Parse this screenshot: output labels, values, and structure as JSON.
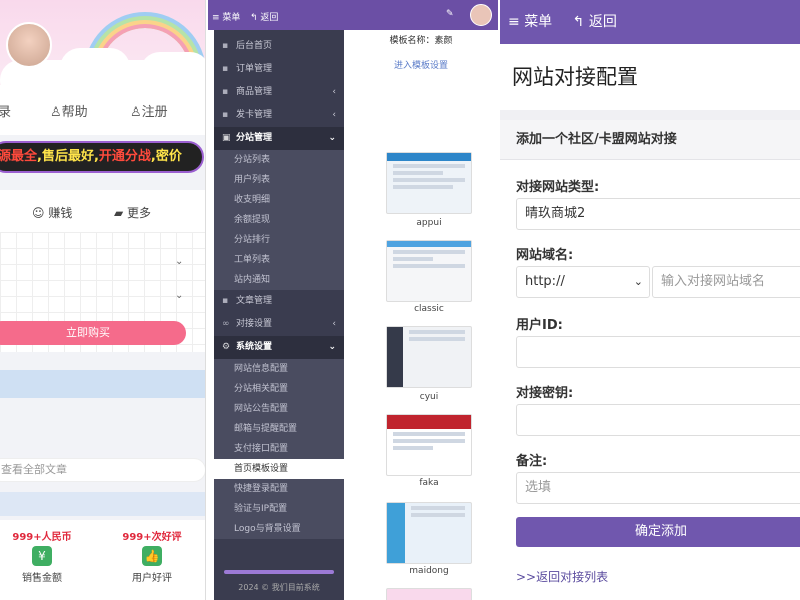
{
  "panel1": {
    "tabs": [
      "录",
      "帮助",
      "注册"
    ],
    "banner": {
      "red1": "源最全",
      "yellow": ",售后最好,",
      "red2": "开通分战",
      "yellow2": ",密价"
    },
    "menu2": [
      "赚钱",
      "更多"
    ],
    "buy": "立即购买",
    "search": "查看全部文章",
    "stats": [
      {
        "n": "999+人民币",
        "l": "销售金额"
      },
      {
        "n": "999+次好评",
        "l": "用户好评"
      }
    ]
  },
  "panel2": {
    "top": {
      "menu": "菜单",
      "back": "返回"
    },
    "sidebar": [
      {
        "t": "后台首页"
      },
      {
        "t": "订单管理"
      },
      {
        "t": "商品管理",
        "arrow": true
      },
      {
        "t": "发卡管理",
        "arrow": true
      },
      {
        "t": "分站管理",
        "arrow": true,
        "active": true
      }
    ],
    "sub1": [
      "分站列表",
      "用户列表",
      "收支明细",
      "余额提现",
      "分站排行",
      "工单列表",
      "站内通知"
    ],
    "sidebar2": [
      {
        "t": "文章管理"
      },
      {
        "t": "对接设置",
        "arrow": true
      },
      {
        "t": "系统设置",
        "arrow": true,
        "active": true
      }
    ],
    "sub2": [
      "网站信息配置",
      "分站相关配置",
      "网站公告配置",
      "邮箱与提醒配置",
      "支付接口配置",
      "首页模板设置",
      "快捷登录配置",
      "验证与IP配置",
      "Logo与背景设置"
    ],
    "current_sub": "首页模板设置",
    "footer": "2024 © 我们目前系统",
    "template_label": "模板名称：素颜",
    "enter_template": "进入模板设置",
    "templates": [
      "appui",
      "classic",
      "cyui",
      "faka",
      "maidong"
    ]
  },
  "panel3": {
    "top": {
      "menu": "菜单",
      "back": "返回"
    },
    "title": "网站对接配置",
    "section": "添加一个社区/卡盟网站对接",
    "type_label": "对接网站类型:",
    "type_value": "晴玖商城2",
    "domain_label": "网站域名:",
    "protocol": "http://",
    "domain_placeholder": "输入对接网站域名",
    "userid_label": "用户ID:",
    "key_label": "对接密钥:",
    "remark_label": "备注:",
    "remark_placeholder": "选填",
    "submit": "确定添加",
    "back_link": ">>返回对接列表"
  }
}
